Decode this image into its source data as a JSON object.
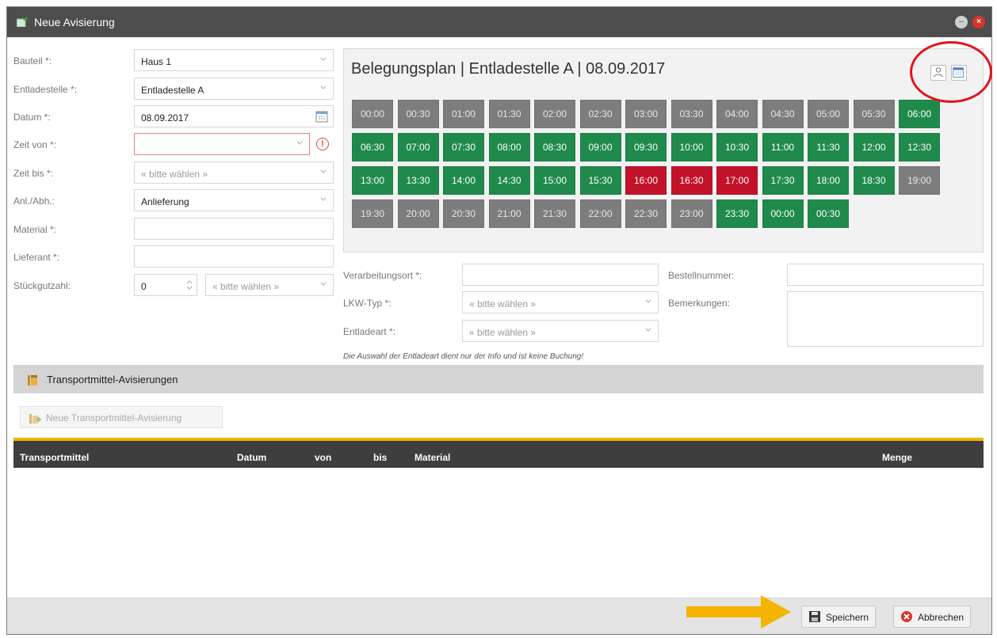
{
  "window": {
    "title": "Neue Avisierung"
  },
  "form": {
    "bauteil": {
      "label": "Bauteil *:",
      "value": "Haus 1"
    },
    "entladestelle": {
      "label": "Entladestelle *:",
      "value": "Entladestelle A"
    },
    "datum": {
      "label": "Datum *:",
      "value": "08.09.2017"
    },
    "zeit_von": {
      "label": "Zeit von *:",
      "value": ""
    },
    "zeit_bis": {
      "label": "Zeit bis *:",
      "placeholder": "« bitte wählen »"
    },
    "anl_abh": {
      "label": "Anl./Abh.:",
      "value": "Anlieferung"
    },
    "material": {
      "label": "Material *:",
      "value": ""
    },
    "lieferant": {
      "label": "Lieferant *:",
      "value": ""
    },
    "stueckgutzahl": {
      "label": "Stückgutzahl:",
      "value": "0",
      "unit_placeholder": "« bitte wählen »"
    }
  },
  "plan": {
    "title": "Belegungsplan | Entladestelle A | 08.09.2017",
    "slots": [
      {
        "time": "00:00",
        "status": "closed"
      },
      {
        "time": "00:30",
        "status": "closed"
      },
      {
        "time": "01:00",
        "status": "closed"
      },
      {
        "time": "01:30",
        "status": "closed"
      },
      {
        "time": "02:00",
        "status": "closed"
      },
      {
        "time": "02:30",
        "status": "closed"
      },
      {
        "time": "03:00",
        "status": "closed"
      },
      {
        "time": "03:30",
        "status": "closed"
      },
      {
        "time": "04:00",
        "status": "closed"
      },
      {
        "time": "04:30",
        "status": "closed"
      },
      {
        "time": "05:00",
        "status": "closed"
      },
      {
        "time": "05:30",
        "status": "closed"
      },
      {
        "time": "06:00",
        "status": "free"
      },
      {
        "time": "06:30",
        "status": "free"
      },
      {
        "time": "07:00",
        "status": "free"
      },
      {
        "time": "07:30",
        "status": "free"
      },
      {
        "time": "08:00",
        "status": "free"
      },
      {
        "time": "08:30",
        "status": "free"
      },
      {
        "time": "09:00",
        "status": "free"
      },
      {
        "time": "09:30",
        "status": "free"
      },
      {
        "time": "10:00",
        "status": "free"
      },
      {
        "time": "10:30",
        "status": "free"
      },
      {
        "time": "11:00",
        "status": "free"
      },
      {
        "time": "11:30",
        "status": "free"
      },
      {
        "time": "12:00",
        "status": "free"
      },
      {
        "time": "12:30",
        "status": "free"
      },
      {
        "time": "13:00",
        "status": "free"
      },
      {
        "time": "13:30",
        "status": "free"
      },
      {
        "time": "14:00",
        "status": "free"
      },
      {
        "time": "14:30",
        "status": "free"
      },
      {
        "time": "15:00",
        "status": "free"
      },
      {
        "time": "15:30",
        "status": "free"
      },
      {
        "time": "16:00",
        "status": "booked"
      },
      {
        "time": "16:30",
        "status": "booked"
      },
      {
        "time": "17:00",
        "status": "booked"
      },
      {
        "time": "17:30",
        "status": "free"
      },
      {
        "time": "18:00",
        "status": "free"
      },
      {
        "time": "18:30",
        "status": "free"
      },
      {
        "time": "19:00",
        "status": "closed"
      },
      {
        "time": "19:30",
        "status": "closed"
      },
      {
        "time": "20:00",
        "status": "closed"
      },
      {
        "time": "20:30",
        "status": "closed"
      },
      {
        "time": "21:00",
        "status": "closed"
      },
      {
        "time": "21:30",
        "status": "closed"
      },
      {
        "time": "22:00",
        "status": "closed"
      },
      {
        "time": "22:30",
        "status": "closed"
      },
      {
        "time": "23:00",
        "status": "closed"
      },
      {
        "time": "23:30",
        "status": "free"
      },
      {
        "time": "00:00",
        "status": "free"
      },
      {
        "time": "00:30",
        "status": "free"
      }
    ]
  },
  "details": {
    "verarbeitungsort": {
      "label": "Verarbeitungsort *:",
      "value": ""
    },
    "lkw_typ": {
      "label": "LKW-Typ *:",
      "placeholder": "« bitte wählen »"
    },
    "entladeart": {
      "label": "Entladeart *:",
      "placeholder": "« bitte wählen »"
    },
    "hint": "Die Auswahl der Entladeart dient nur der Info und ist keine Buchung!",
    "bestellnummer": {
      "label": "Bestellnummer:",
      "value": ""
    },
    "bemerkungen": {
      "label": "Bemerkungen:",
      "value": ""
    }
  },
  "transport": {
    "section_title": "Transportmittel-Avisierungen",
    "new_button": "Neue Transportmittel-Avisierung",
    "columns": [
      "Transportmittel",
      "Datum",
      "von",
      "bis",
      "Material",
      "Menge"
    ]
  },
  "footer": {
    "save": "Speichern",
    "cancel": "Abbrechen"
  },
  "colors": {
    "free": "#1f8a4c",
    "closed": "#7d7d7d",
    "booked": "#c2122a",
    "accent": "#f0b400"
  }
}
